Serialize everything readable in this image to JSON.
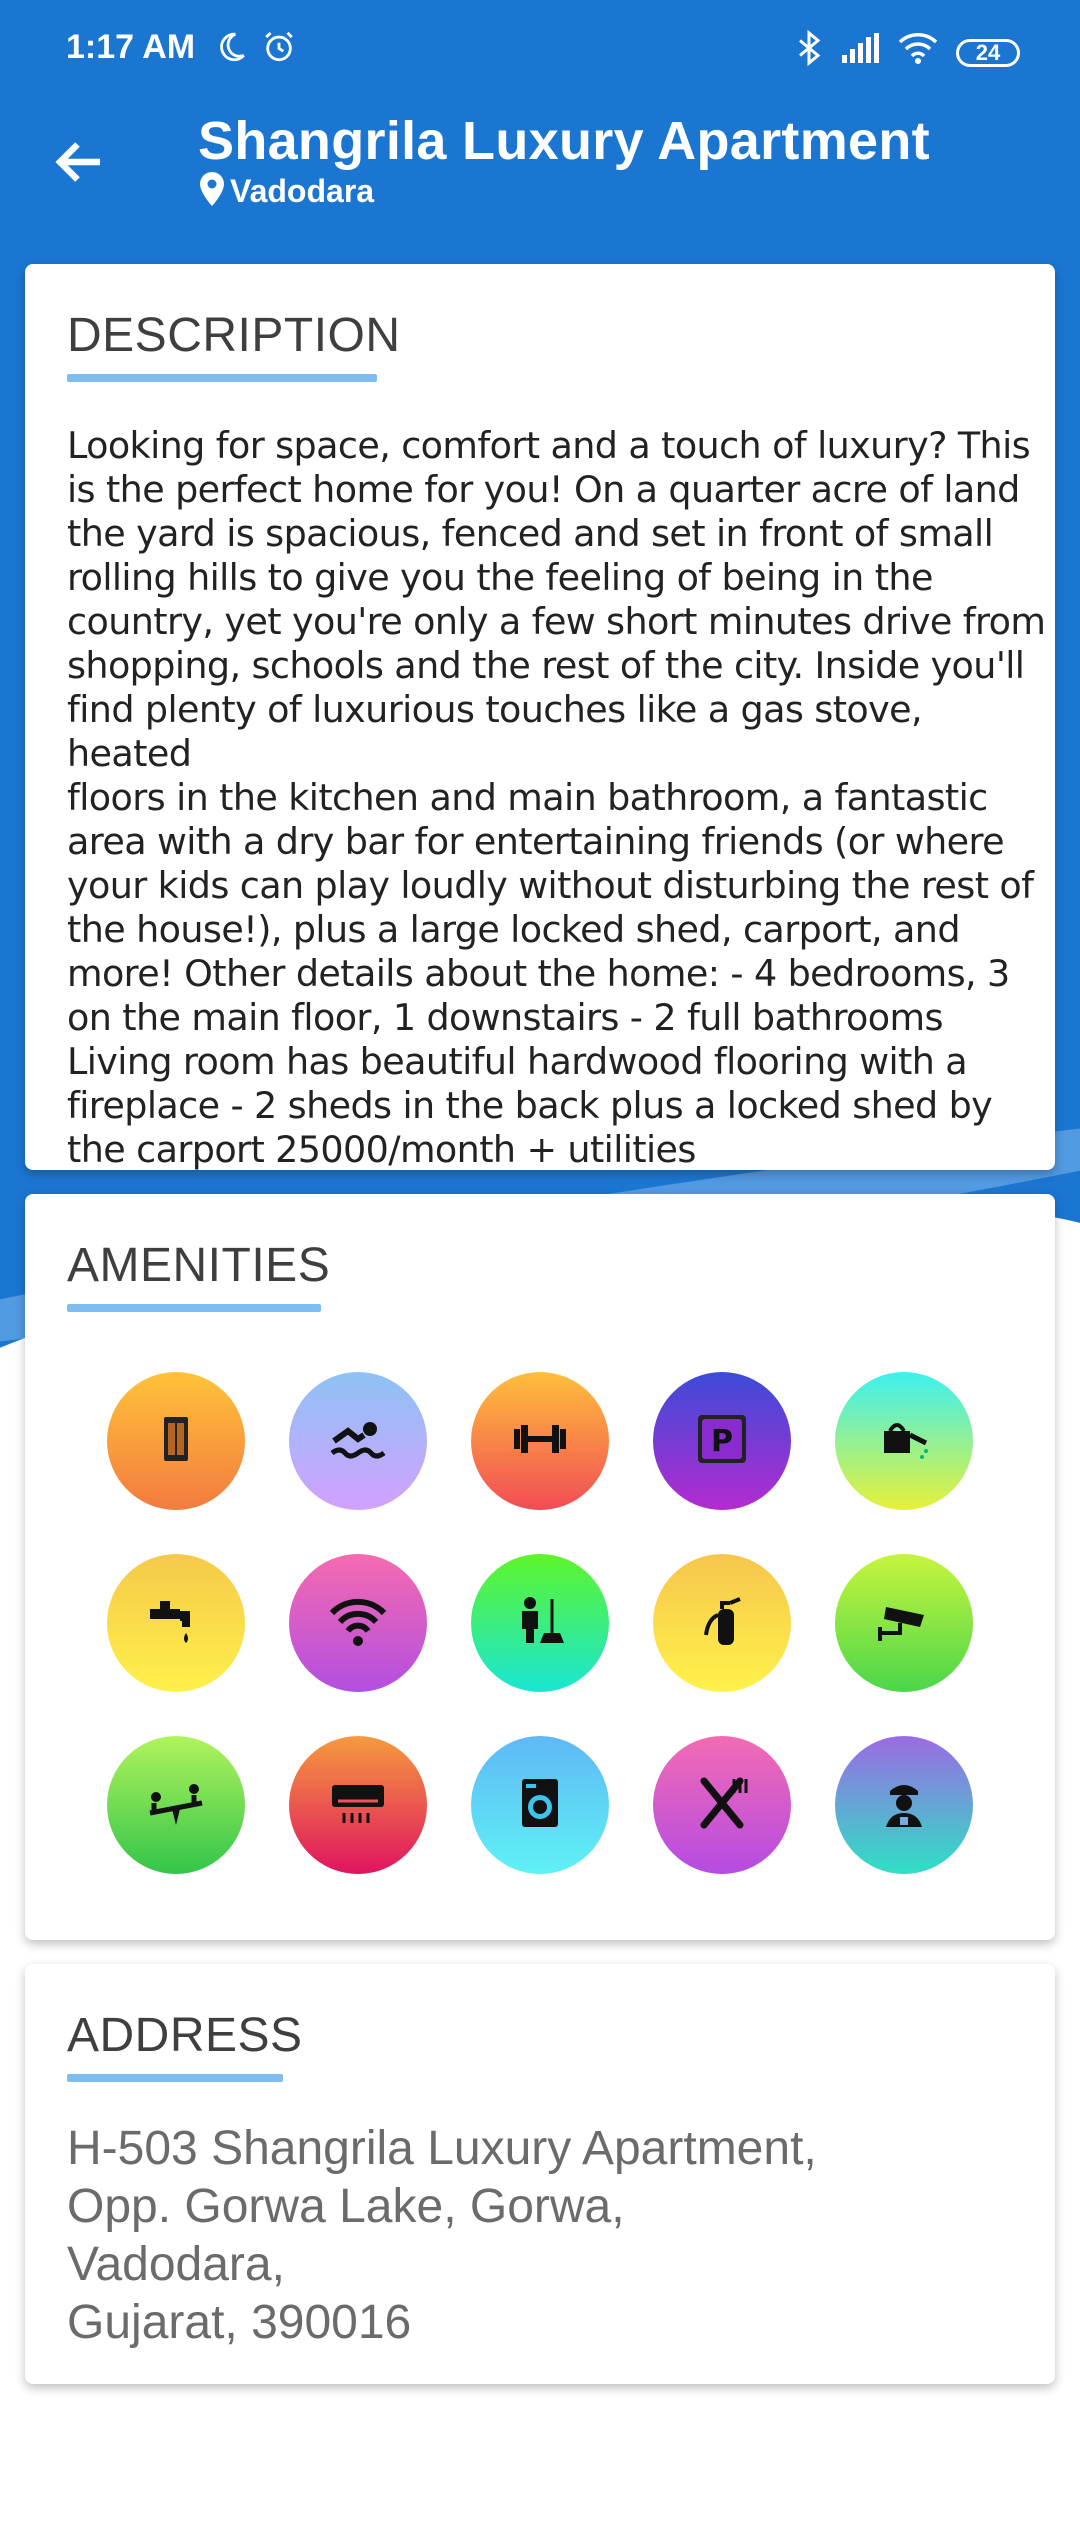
{
  "status": {
    "time": "1:17 AM",
    "battery": "24"
  },
  "header": {
    "title": "Shangrila Luxury Apartment",
    "location": "Vadodara"
  },
  "description": {
    "heading": "DESCRIPTION",
    "lines": [
      "Looking for space, comfort and a touch of luxury? This",
      "is the perfect home for you!  On a quarter acre of land",
      "the yard is spacious, fenced and set in front of small",
      "rolling hills to give you the feeling of being in the",
      "country, yet you're only a few short minutes drive from",
      "shopping, schools and the rest of the city.  Inside you'll",
      "find plenty of luxurious touches like a gas stove, heated",
      "floors in the kitchen and main bathroom, a fantastic",
      "area with a dry bar for entertaining friends (or where",
      "your kids can play loudly without disturbing the rest of",
      "the house!), plus a large locked shed, carport, and",
      "more!  Other details about the home: - 4 bedrooms, 3",
      "on the main floor, 1 downstairs - 2 full bathrooms",
      "Living room has beautiful hardwood flooring with a",
      "fireplace - 2 sheds in the back plus a locked shed by",
      "the carport  25000/month + utilities"
    ]
  },
  "amenities": {
    "heading": "AMENITIES",
    "items": [
      {
        "icon": "lift-icon",
        "c1": "#ffc33a",
        "c2": "#f27b3f"
      },
      {
        "icon": "swimming-pool-icon",
        "c1": "#8ec2f5",
        "c2": "#d2a1ff"
      },
      {
        "icon": "gym-icon",
        "c1": "#ffbf3b",
        "c2": "#f24c55"
      },
      {
        "icon": "parking-icon",
        "c1": "#3c4bd8",
        "c2": "#b42bd0"
      },
      {
        "icon": "garden-watering-icon",
        "c1": "#3df0f0",
        "c2": "#e7f03a"
      },
      {
        "icon": "water-tap-icon",
        "c1": "#f5c94a",
        "c2": "#fff04a"
      },
      {
        "icon": "wifi-icon",
        "c1": "#f56bb1",
        "c2": "#b34ee0"
      },
      {
        "icon": "housekeeping-icon",
        "c1": "#5ef52a",
        "c2": "#19e6d3"
      },
      {
        "icon": "fire-extinguisher-icon",
        "c1": "#f6c64c",
        "c2": "#fff24a"
      },
      {
        "icon": "cctv-icon",
        "c1": "#c6f53d",
        "c2": "#4bd64a"
      },
      {
        "icon": "playground-icon",
        "c1": "#b0f35c",
        "c2": "#33c54a"
      },
      {
        "icon": "air-conditioner-icon",
        "c1": "#f59a3e",
        "c2": "#e0145f"
      },
      {
        "icon": "laundry-icon",
        "c1": "#5fb8f5",
        "c2": "#5ff1f5"
      },
      {
        "icon": "restaurant-icon",
        "c1": "#f26bb3",
        "c2": "#b54be3"
      },
      {
        "icon": "security-guard-icon",
        "c1": "#9b6be3",
        "c2": "#2ee0c6"
      }
    ]
  },
  "address": {
    "heading": "ADDRESS",
    "lines": [
      "H-503 Shangrila Luxury Apartment,",
      "Opp. Gorwa Lake, Gorwa,",
      "Vadodara,",
      "Gujarat, 390016"
    ]
  }
}
